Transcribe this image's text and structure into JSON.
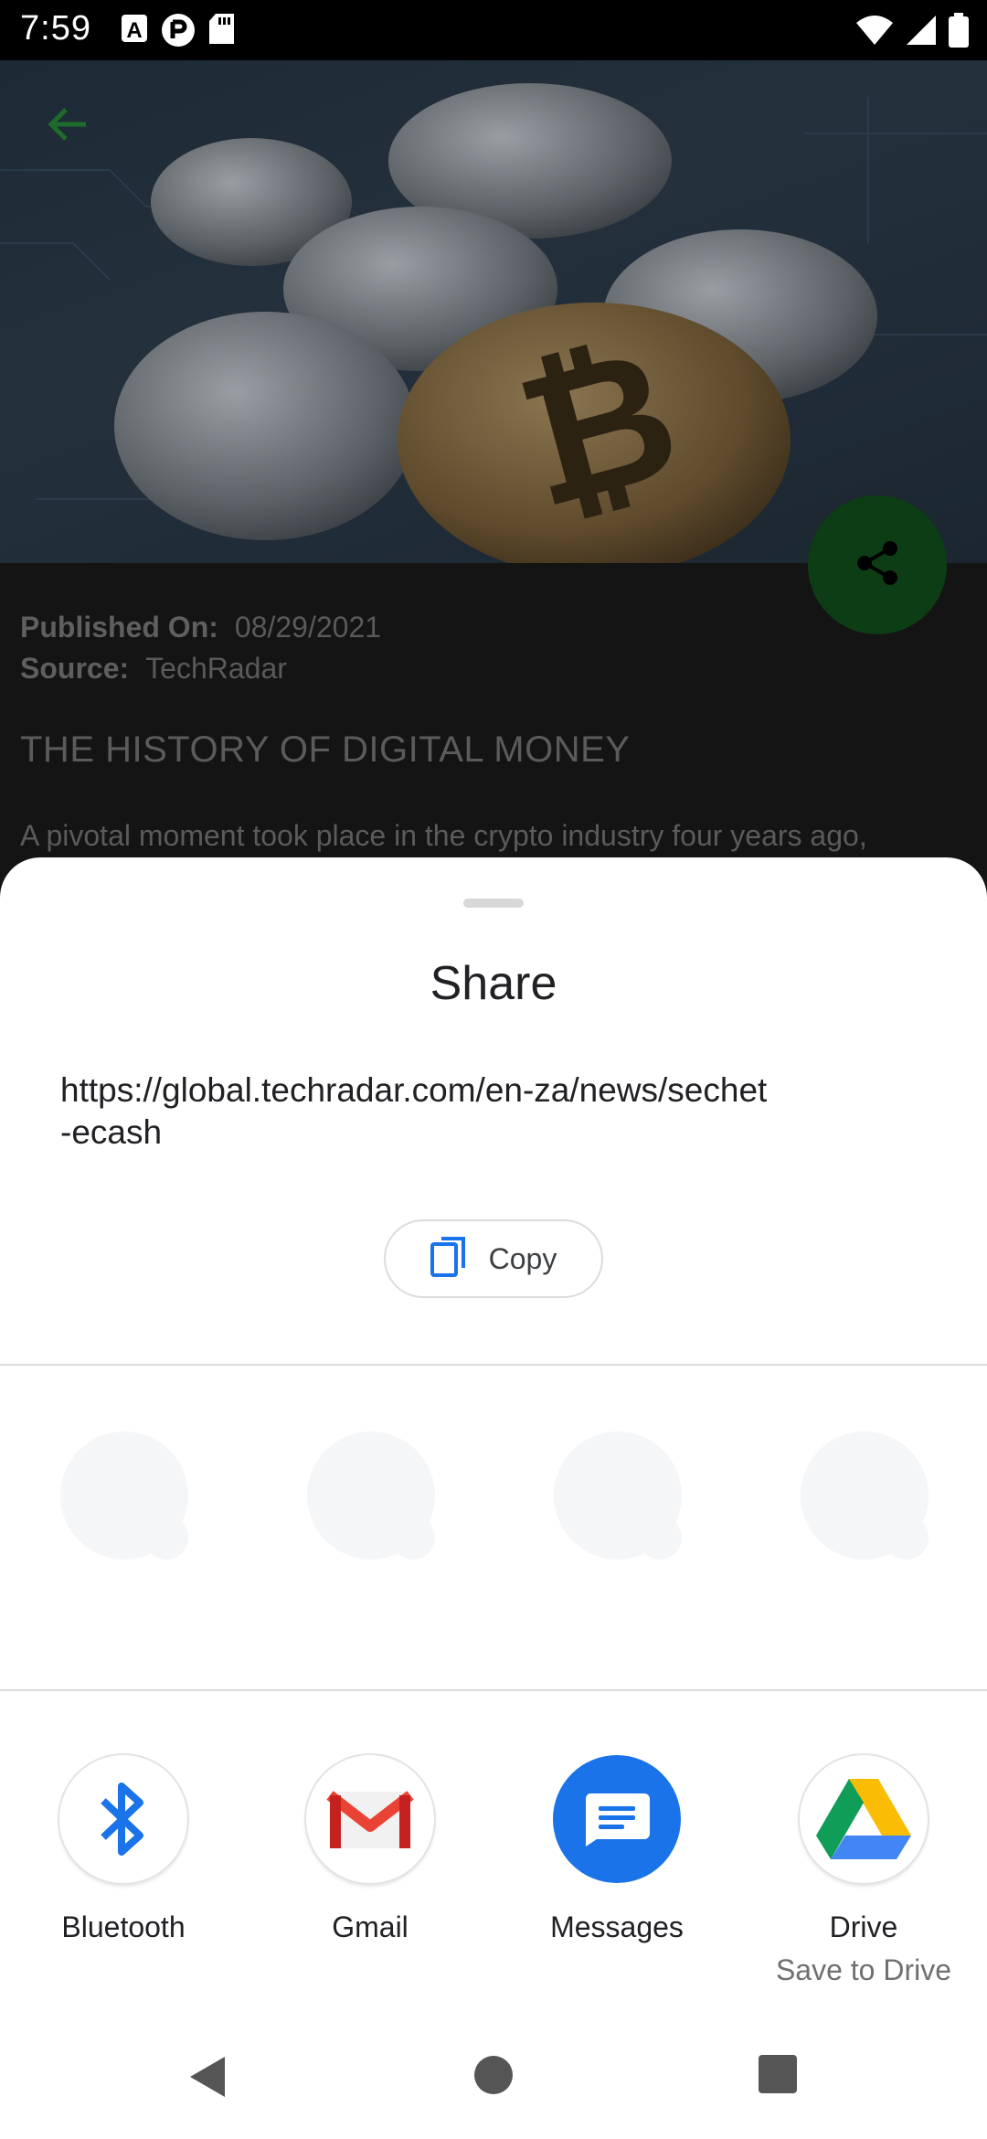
{
  "status_bar": {
    "time": "7:59",
    "left_icons": [
      "text-a-icon",
      "sync-icon",
      "sd-card-icon"
    ],
    "right_icons": [
      "wifi-icon",
      "signal-icon",
      "battery-icon"
    ]
  },
  "article": {
    "published_label": "Published On:",
    "published_value": "08/29/2021",
    "source_label": "Source:",
    "source_value": "TechRadar",
    "title": "THE HISTORY OF DIGITAL MONEY",
    "body_preview": "A pivotal moment took place in the crypto industry four years ago,"
  },
  "share_sheet": {
    "title": "Share",
    "url": "https://global.techradar.com/en-za/news/sechet-ecash",
    "url_line1": "https://global.techradar.com/en-za/news/sechet",
    "url_line2": "-ecash",
    "copy_label": "Copy",
    "apps": [
      {
        "label": "Bluetooth",
        "icon": "bluetooth-icon"
      },
      {
        "label": "Gmail",
        "icon": "gmail-icon"
      },
      {
        "label": "Messages",
        "icon": "messages-icon"
      },
      {
        "label": "Drive",
        "sublabel": "Save to Drive",
        "icon": "drive-icon"
      }
    ]
  },
  "colors": {
    "messages_blue": "#1a73e8",
    "fab_green": "#0d3d14",
    "gmail_red": "#ea4335"
  }
}
